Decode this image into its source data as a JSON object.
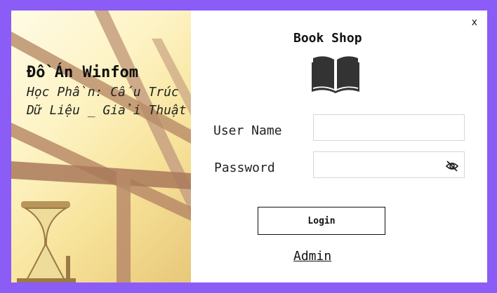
{
  "window": {
    "close_label": "x"
  },
  "left_panel": {
    "title": "Đồ Án Winfom",
    "subtitle": "Học Phần: Cấu Trúc Dữ Liệu _ Giải Thuật"
  },
  "header": {
    "title": "Book Shop",
    "icon": "book-open-icon"
  },
  "form": {
    "username_label": "User Name",
    "username_value": "",
    "password_label": "Password",
    "password_value": "",
    "eye_icon": "eye-slash-icon",
    "login_label": "Login",
    "admin_label": "Admin"
  },
  "colors": {
    "frame": "#8b5cf6",
    "window_bg": "#ffffff",
    "text": "#111111"
  }
}
